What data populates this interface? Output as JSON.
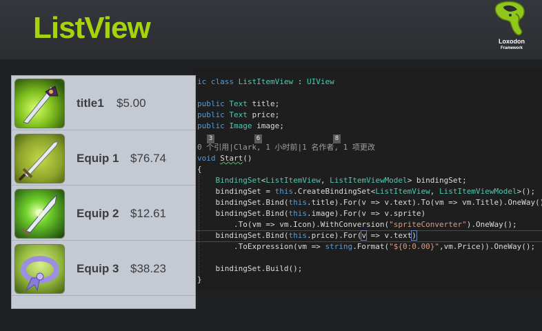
{
  "header": {
    "title": "ListView",
    "logo": {
      "name": "Loxodon",
      "sub": "Framework"
    }
  },
  "list": {
    "items": [
      {
        "title": "title1",
        "price": "$5.00",
        "icon": "dagger-icon"
      },
      {
        "title": "Equip 1",
        "price": "$76.74",
        "icon": "sword-icon"
      },
      {
        "title": "Equip 2",
        "price": "$12.61",
        "icon": "glowing-blade-icon"
      },
      {
        "title": "Equip 3",
        "price": "$38.23",
        "icon": "ribbon-necklace-icon"
      }
    ]
  },
  "code": {
    "ref_numbers": [
      "3",
      "6",
      "8"
    ],
    "lines": [
      "ic class ListItemView : UIView",
      "public Text title;",
      "public Text price;",
      "public Image image;",
      "0 个引用|Clark, 1 小时前|1 名作者, 1 项更改",
      "void Start()",
      "{",
      "    BindingSet<ListItemView, ListItemViewModel> bindingSet;",
      "    bindingSet = this.CreateBindingSet<ListItemView, ListItemViewModel>();",
      "    bindingSet.Bind(this.title).For(v => v.text).To(vm => vm.Title).OneWay();",
      "    bindingSet.Bind(this.image).For(v => v.sprite)",
      "        .To(vm => vm.Icon).WithConversion(\"spriteConverter\").OneWay();",
      "    bindingSet.Bind(this.price).For(v => v.text)",
      "        .ToExpression(vm => string.Format(\"${0:0.00}\",vm.Price)).OneWay();",
      "    bindingSet.Build();",
      "}"
    ]
  },
  "colors": {
    "title_green": "#a5d40d",
    "keyword_blue": "#569cd6",
    "type_teal": "#4ec9b0",
    "string_orange": "#d69d85",
    "list_bg": "#c5cad2"
  }
}
